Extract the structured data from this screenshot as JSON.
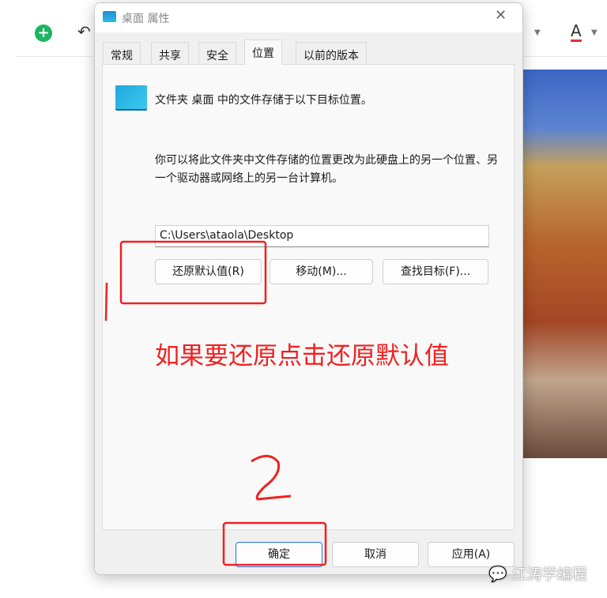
{
  "background_app": {
    "add_icon": "plus-circle-icon",
    "undo_icon": "undo-icon",
    "font_color_label": "A",
    "font_color": "#e0303a"
  },
  "dialog": {
    "title": "桌面 属性",
    "tabs": [
      "常规",
      "共享",
      "安全",
      "位置",
      "以前的版本"
    ],
    "active_tab": "位置",
    "info_line": "文件夹 桌面 中的文件存储于以下目标位置。",
    "description": "你可以将此文件夹中文件存储的位置更改为此硬盘上的另一个位置、另一个驱动器或网络上的另一台计算机。",
    "path_value": "C:\\Users\\ataola\\Desktop",
    "buttons": {
      "restore": "还原默认值(R)",
      "move": "移动(M)...",
      "find": "查找目标(F)..."
    },
    "footer": {
      "ok": "确定",
      "cancel": "取消",
      "apply": "应用(A)"
    }
  },
  "annotations": {
    "text": "如果要还原点击还原默认值",
    "mark1": "1",
    "mark2": "2",
    "color": "#f02020"
  },
  "watermark": "江涛学编程"
}
